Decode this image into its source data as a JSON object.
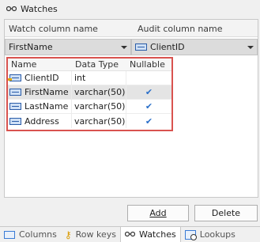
{
  "window": {
    "title": "Watches",
    "title_icon": "glasses-icon"
  },
  "columns_header": {
    "watch": "Watch column name",
    "audit": "Audit column name"
  },
  "watch_select": {
    "value": "FirstName"
  },
  "audit_select": {
    "value": "ClientID",
    "icon": "field-icon"
  },
  "grid": {
    "headers": {
      "name": "Name",
      "type": "Data Type",
      "nullable": "Nullable"
    },
    "rows": [
      {
        "name": "ClientID",
        "type": "int",
        "nullable": "",
        "icon": "key-field-icon",
        "selected": false
      },
      {
        "name": "FirstName",
        "type": "varchar(50)",
        "nullable": "✔",
        "icon": "field-icon",
        "selected": true
      },
      {
        "name": "LastName",
        "type": "varchar(50)",
        "nullable": "✔",
        "icon": "field-icon",
        "selected": false
      },
      {
        "name": "Address",
        "type": "varchar(50)",
        "nullable": "✔",
        "icon": "field-icon",
        "selected": false
      }
    ]
  },
  "buttons": {
    "add": "Add",
    "delete": "Delete"
  },
  "tabs": [
    {
      "label": "Columns",
      "icon": "table-icon",
      "active": false
    },
    {
      "label": "Row keys",
      "icon": "key-icon",
      "active": false
    },
    {
      "label": "Watches",
      "icon": "glasses-icon",
      "active": true
    },
    {
      "label": "Lookups",
      "icon": "lookup-icon",
      "active": false
    }
  ],
  "colors": {
    "highlight_border": "#d9534f",
    "check": "#2a6fc9"
  }
}
